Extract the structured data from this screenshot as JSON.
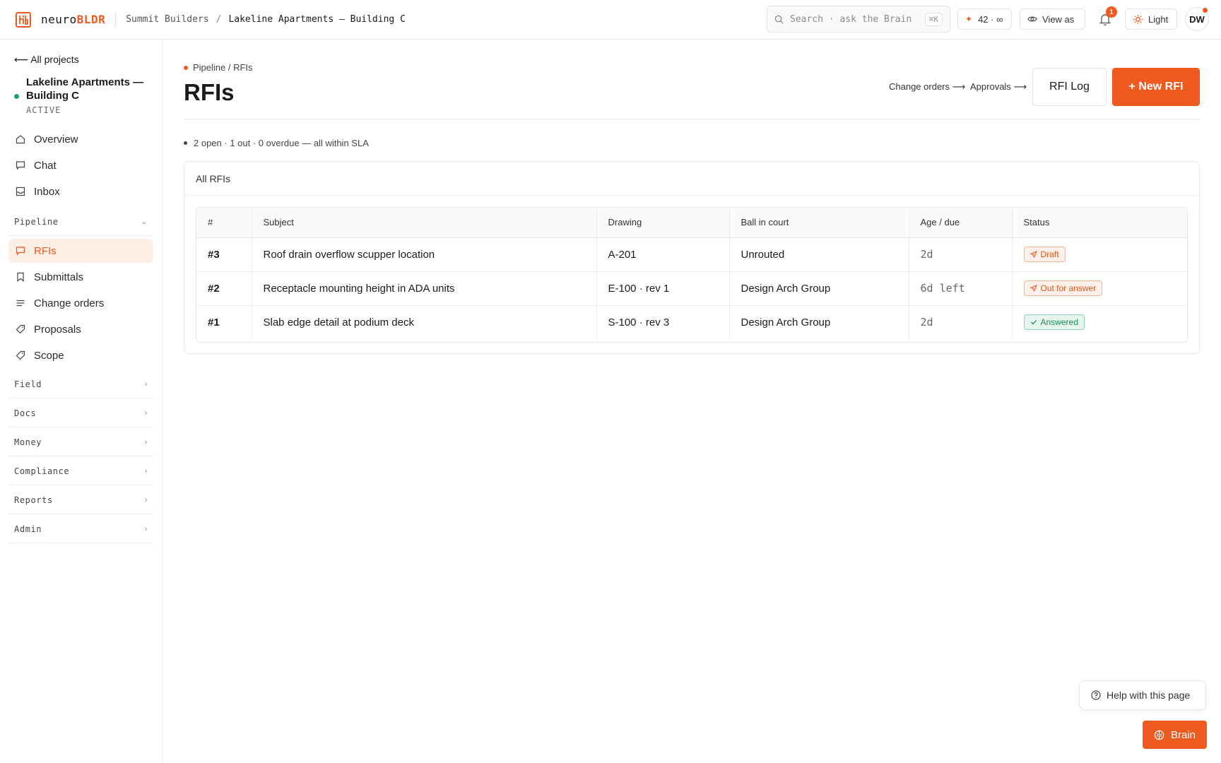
{
  "brand": {
    "name_prefix": "neuro",
    "name_suffix": "BLDR",
    "accent": "#f05a1e"
  },
  "topbar": {
    "org": "Summit Builders",
    "separator": "/",
    "project": "Lakeline Apartments — Building C",
    "search_placeholder": "Search · ask the Brain",
    "search_shortcut": "⌘K",
    "credits": "42 · ∞",
    "view_as": "View as",
    "notifications_count": "1",
    "theme": "Light",
    "avatar_initials": "DW"
  },
  "sidebar": {
    "back": "⟵ All projects",
    "project_name": "Lakeline Apartments — Building C",
    "project_status": "ACTIVE",
    "top_items": [
      {
        "label": "Overview",
        "icon": "home-icon"
      },
      {
        "label": "Chat",
        "icon": "chat-icon"
      },
      {
        "label": "Inbox",
        "icon": "inbox-icon"
      }
    ],
    "pipeline_label": "Pipeline",
    "pipeline_items": [
      {
        "label": "RFIs",
        "icon": "rfi-icon",
        "active": true
      },
      {
        "label": "Submittals",
        "icon": "bookmark-icon"
      },
      {
        "label": "Change orders",
        "icon": "list-icon"
      },
      {
        "label": "Proposals",
        "icon": "tag-icon"
      },
      {
        "label": "Scope",
        "icon": "tag-icon"
      }
    ],
    "sections": [
      "Field",
      "Docs",
      "Money",
      "Compliance",
      "Reports",
      "Admin"
    ]
  },
  "main": {
    "breadcrumb": "Pipeline / RFIs",
    "title": "RFIs",
    "links": {
      "change_orders": "Change orders ⟶",
      "approvals": "Approvals ⟶"
    },
    "rfi_log": "RFI Log",
    "new_rfi": "+ New RFI",
    "summary": "2 open · 1 out · 0 overdue — all within SLA",
    "card_title": "All RFIs",
    "table": {
      "headers": [
        "#",
        "Subject",
        "Drawing",
        "Ball in court",
        "Age / due",
        "Status"
      ],
      "rows": [
        {
          "num": "#3",
          "subject": "Roof drain overflow scupper location",
          "drawing": "A-201",
          "ball": "Unrouted",
          "age": "2d",
          "status": "Draft",
          "status_tone": "orange"
        },
        {
          "num": "#2",
          "subject": "Receptacle mounting height in ADA units",
          "drawing": "E-100 · rev 1",
          "ball": "Design Arch Group",
          "age": "6d left",
          "status": "Out for answer",
          "status_tone": "orange"
        },
        {
          "num": "#1",
          "subject": "Slab edge detail at podium deck",
          "drawing": "S-100 · rev 3",
          "ball": "Design Arch Group",
          "age": "2d",
          "status": "Answered",
          "status_tone": "green"
        }
      ]
    }
  },
  "help": "Help with this page",
  "brain": "Brain"
}
